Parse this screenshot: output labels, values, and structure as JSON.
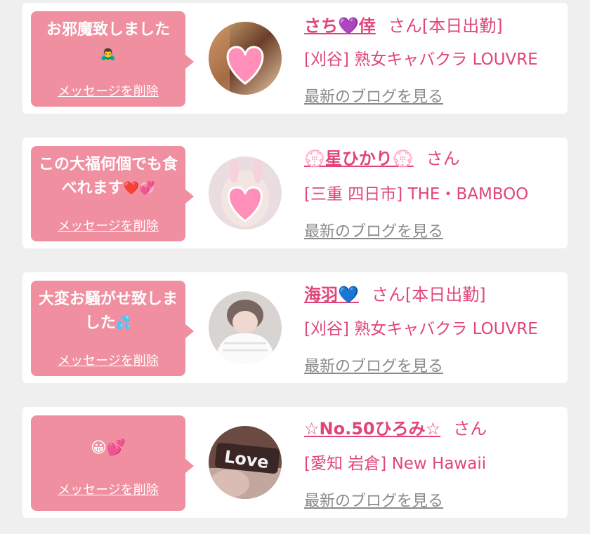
{
  "colors": {
    "accent": "#e0457a",
    "bubble": "#f08fa0",
    "link_gray": "#8a8a8a",
    "background": "#efefef"
  },
  "messages": [
    {
      "greeting": "お邪魔致しました",
      "greeting_emoji": "🙇‍♂️",
      "delete_label": "メッセージを削除",
      "name": "さち💜倖",
      "san": "さん[本日出勤]",
      "shop": "[刈谷] 熟女キャバクラ LOUVRE",
      "blog_link": "最新のブログを見る",
      "avatar_icon": "heart-sticker-photo"
    },
    {
      "greeting": "この大福何個でも食べれます",
      "greeting_emoji": "❤️💞",
      "delete_label": "メッセージを削除",
      "name": "💮星ひかり💮",
      "san": "さん",
      "shop": "[三重 四日市] THE・BAMBOO",
      "blog_link": "最新のブログを見る",
      "avatar_icon": "heart-sticker-photo"
    },
    {
      "greeting": "大変お騒がせ致しました",
      "greeting_emoji": "💦",
      "delete_label": "メッセージを削除",
      "name": "海羽💙",
      "san": "さん[本日出勤]",
      "shop": "[刈谷] 熟女キャバクラ LOUVRE",
      "blog_link": "最新のブログを見る",
      "avatar_icon": "portrait-photo"
    },
    {
      "greeting": "",
      "greeting_emoji": "😀💕",
      "delete_label": "メッセージを削除",
      "name": "☆No.50ひろみ☆",
      "san": "さん",
      "shop": "[愛知 岩倉] New Hawaii",
      "blog_link": "最新のブログを見る",
      "avatar_icon": "love-print-photo",
      "avatar_text": "Love"
    }
  ]
}
